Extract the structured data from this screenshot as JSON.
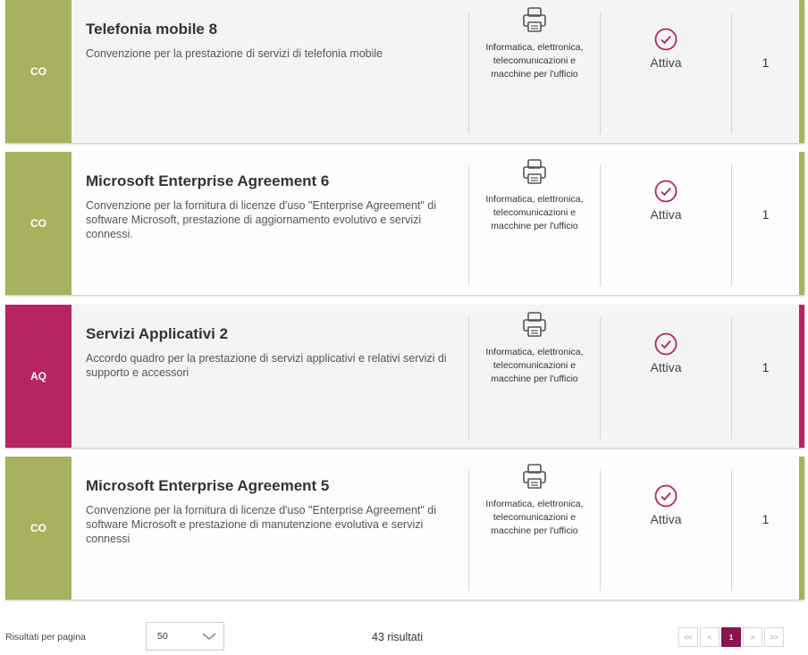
{
  "colors": {
    "co": "#a8b25e",
    "aq": "#b8245f",
    "accent": "#b8245f",
    "page_active": "#8b1550"
  },
  "cards": [
    {
      "badge": "CO",
      "title": "Telefonia mobile 8",
      "description": "Convenzione per la prestazione di servizi di telefonia mobile",
      "category": "Informatica, elettronica, telecomunicazioni e macchine per l'ufficio",
      "category_icon": "printer-icon",
      "status_icon": "check-circle-icon",
      "status": "Attiva",
      "count": "1"
    },
    {
      "badge": "CO",
      "title": "Microsoft Enterprise Agreement 6",
      "description": "Convenzione per la fornitura di licenze d'uso \"Enterprise Agreement\" di software Microsoft, prestazione di aggiornamento evolutivo e servizi connessi.",
      "category": "Informatica, elettronica, telecomunicazioni e macchine per l'ufficio",
      "category_icon": "printer-icon",
      "status_icon": "check-circle-icon",
      "status": "Attiva",
      "count": "1"
    },
    {
      "badge": "AQ",
      "title": "Servizi Applicativi 2",
      "description": "Accordo quadro per la prestazione di servizi applicativi e relativi servizi di supporto e accessori",
      "category": "Informatica, elettronica, telecomunicazioni e macchine per l'ufficio",
      "category_icon": "printer-icon",
      "status_icon": "check-circle-icon",
      "status": "Attiva",
      "count": "1"
    },
    {
      "badge": "CO",
      "title": "Microsoft Enterprise Agreement 5",
      "description": "Convenzione per la fornitura di licenze d'uso \"Enterprise Agreement\" di software Microsoft e prestazione di manutenzione evolutiva e servizi connessi",
      "category": "Informatica, elettronica, telecomunicazioni e macchine per l'ufficio",
      "category_icon": "printer-icon",
      "status_icon": "check-circle-icon",
      "status": "Attiva",
      "count": "1"
    }
  ],
  "footer": {
    "per_page_label": "Risultati per pagina",
    "per_page_value": "50",
    "results_text": "43 risultati",
    "pagination": {
      "first": "<<",
      "prev": "<",
      "current": "1",
      "next": ">",
      "last": ">>"
    }
  }
}
